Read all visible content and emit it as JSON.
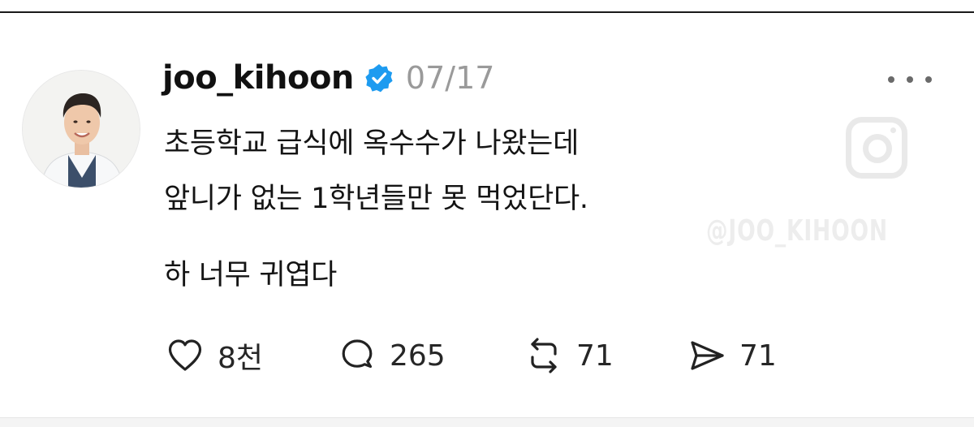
{
  "post": {
    "username": "joo_kihoon",
    "date": "07/17",
    "text_lines": [
      "초등학교 급식에 옥수수가 나왔는데",
      "앞니가 없는 1학년들만 못 먹었단다.",
      "하 너무 귀엽다"
    ],
    "watermark": "@JOO_KIHOON"
  },
  "actions": {
    "like_count": "8천",
    "comment_count": "265",
    "repost_count": "71",
    "share_count": "71"
  },
  "colors": {
    "verified_badge": "#1d9bf0",
    "muted_text": "#9a9a9a",
    "watermark": "#e9e9e9"
  },
  "icons": {
    "verified": "verified-badge-icon",
    "more": "more-dots-icon",
    "like": "heart-icon",
    "comment": "comment-bubble-icon",
    "repost": "repost-arrows-icon",
    "share": "paper-plane-icon",
    "instagram": "instagram-logo-icon"
  }
}
